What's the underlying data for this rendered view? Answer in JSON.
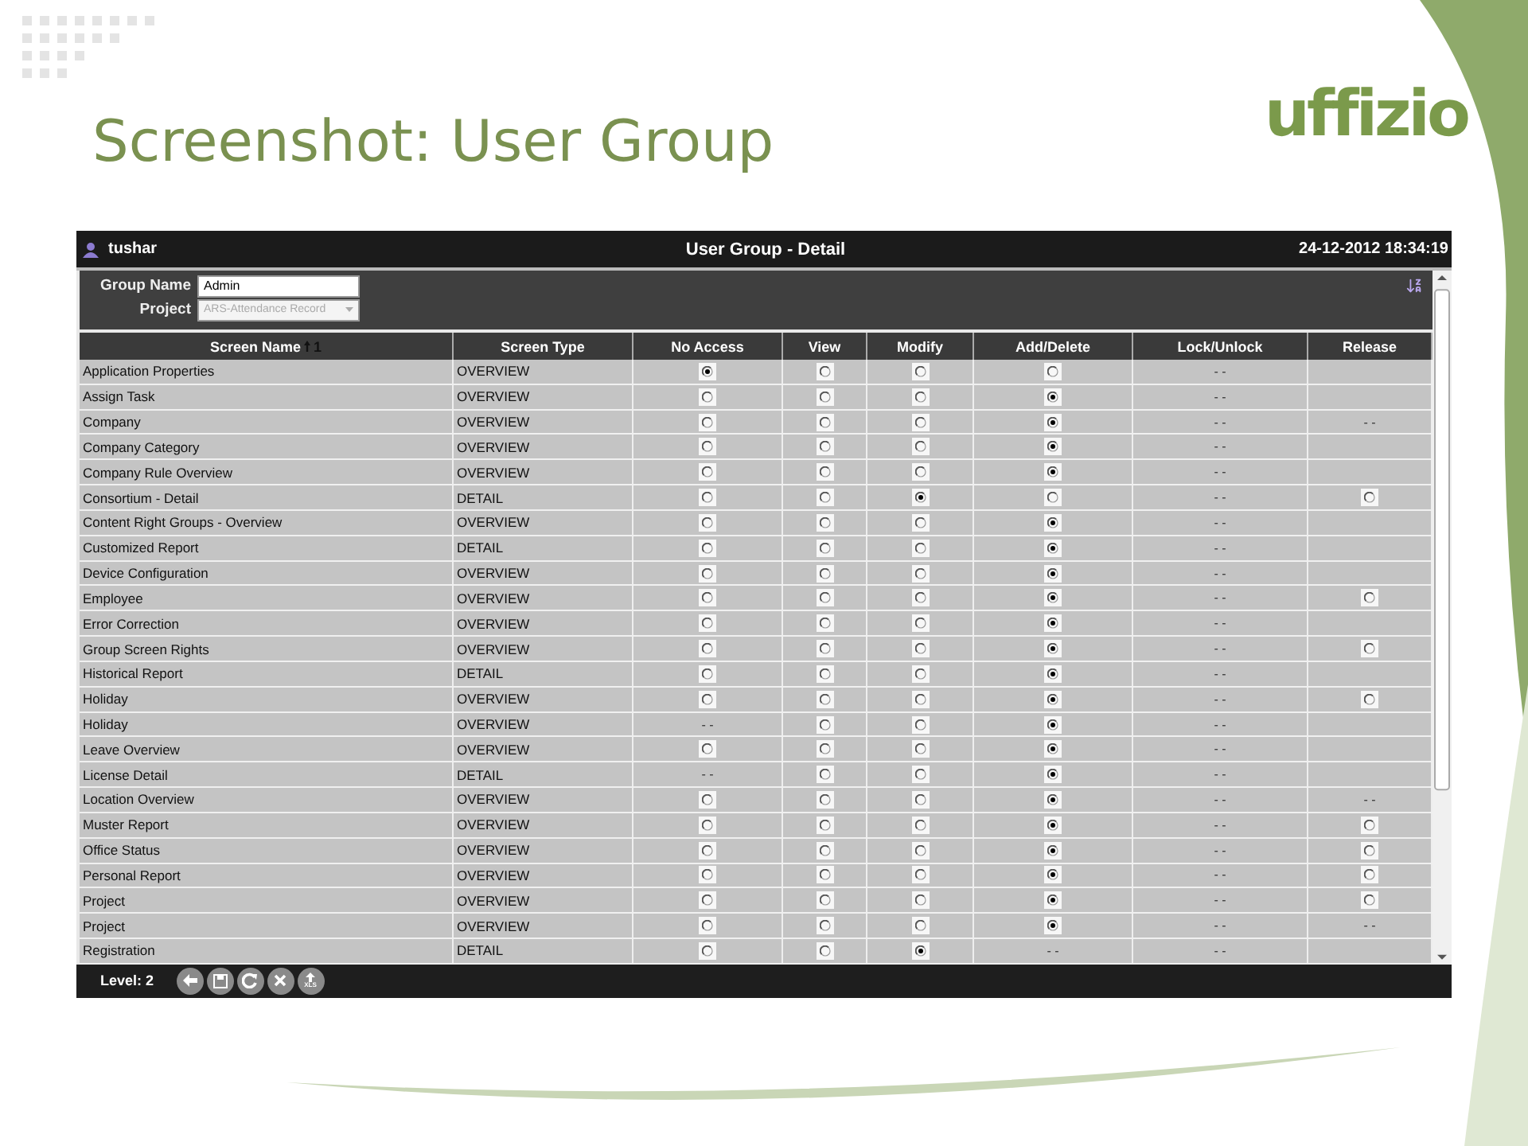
{
  "slide": {
    "title": "Screenshot: User Group",
    "logo": "uffizio"
  },
  "window": {
    "user": "tushar",
    "title": "User Group - Detail",
    "datetime": "24-12-2012 18:34:19"
  },
  "form": {
    "group_name_label": "Group Name",
    "group_name": "Admin",
    "project_label": "Project",
    "project": "ARS-Attendance Record"
  },
  "table": {
    "columns": [
      {
        "label": "Screen Name",
        "sort_rank": "1"
      },
      {
        "label": "Screen Type"
      },
      {
        "label": "No Access"
      },
      {
        "label": "View"
      },
      {
        "label": "Modify"
      },
      {
        "label": "Add/Delete"
      },
      {
        "label": "Lock/Unlock"
      },
      {
        "label": "Release"
      }
    ],
    "rows": [
      {
        "cells": [
          {
            "kind": "text",
            "text": "Application Properties"
          },
          {
            "kind": "text",
            "text": "OVERVIEW"
          },
          {
            "kind": "radio",
            "selected": true
          },
          {
            "kind": "radio",
            "selected": false
          },
          {
            "kind": "radio",
            "selected": false
          },
          {
            "kind": "radio",
            "selected": false
          },
          {
            "kind": "dash",
            "text": "- -"
          },
          {
            "kind": "empty"
          }
        ]
      },
      {
        "cells": [
          {
            "kind": "text",
            "text": "Assign Task"
          },
          {
            "kind": "text",
            "text": "OVERVIEW"
          },
          {
            "kind": "radio",
            "selected": false
          },
          {
            "kind": "radio",
            "selected": false
          },
          {
            "kind": "radio",
            "selected": false
          },
          {
            "kind": "radio",
            "selected": true
          },
          {
            "kind": "dash",
            "text": "- -"
          },
          {
            "kind": "empty"
          }
        ]
      },
      {
        "cells": [
          {
            "kind": "text",
            "text": "Company"
          },
          {
            "kind": "text",
            "text": "OVERVIEW"
          },
          {
            "kind": "radio",
            "selected": false
          },
          {
            "kind": "radio",
            "selected": false
          },
          {
            "kind": "radio",
            "selected": false
          },
          {
            "kind": "radio",
            "selected": true
          },
          {
            "kind": "dash",
            "text": "- -"
          },
          {
            "kind": "dash",
            "text": "- -"
          }
        ]
      },
      {
        "cells": [
          {
            "kind": "text",
            "text": "Company Category"
          },
          {
            "kind": "text",
            "text": "OVERVIEW"
          },
          {
            "kind": "radio",
            "selected": false
          },
          {
            "kind": "radio",
            "selected": false
          },
          {
            "kind": "radio",
            "selected": false
          },
          {
            "kind": "radio",
            "selected": true
          },
          {
            "kind": "dash",
            "text": "- -"
          },
          {
            "kind": "empty"
          }
        ]
      },
      {
        "cells": [
          {
            "kind": "text",
            "text": "Company Rule Overview"
          },
          {
            "kind": "text",
            "text": "OVERVIEW"
          },
          {
            "kind": "radio",
            "selected": false
          },
          {
            "kind": "radio",
            "selected": false
          },
          {
            "kind": "radio",
            "selected": false
          },
          {
            "kind": "radio",
            "selected": true
          },
          {
            "kind": "dash",
            "text": "- -"
          },
          {
            "kind": "empty"
          }
        ]
      },
      {
        "cells": [
          {
            "kind": "text",
            "text": "Consortium - Detail"
          },
          {
            "kind": "text",
            "text": "DETAIL"
          },
          {
            "kind": "radio",
            "selected": false
          },
          {
            "kind": "radio",
            "selected": false
          },
          {
            "kind": "radio",
            "selected": true
          },
          {
            "kind": "radio",
            "selected": false
          },
          {
            "kind": "dash",
            "text": "- -"
          },
          {
            "kind": "radio",
            "selected": false
          }
        ]
      },
      {
        "cells": [
          {
            "kind": "text",
            "text": "Content Right Groups - Overview"
          },
          {
            "kind": "text",
            "text": "OVERVIEW"
          },
          {
            "kind": "radio",
            "selected": false
          },
          {
            "kind": "radio",
            "selected": false
          },
          {
            "kind": "radio",
            "selected": false
          },
          {
            "kind": "radio",
            "selected": true
          },
          {
            "kind": "dash",
            "text": "- -"
          },
          {
            "kind": "empty"
          }
        ]
      },
      {
        "cells": [
          {
            "kind": "text",
            "text": "Customized Report"
          },
          {
            "kind": "text",
            "text": "DETAIL"
          },
          {
            "kind": "radio",
            "selected": false
          },
          {
            "kind": "radio",
            "selected": false
          },
          {
            "kind": "radio",
            "selected": false
          },
          {
            "kind": "radio",
            "selected": true
          },
          {
            "kind": "dash",
            "text": "- -"
          },
          {
            "kind": "empty"
          }
        ]
      },
      {
        "cells": [
          {
            "kind": "text",
            "text": "Device Configuration"
          },
          {
            "kind": "text",
            "text": "OVERVIEW"
          },
          {
            "kind": "radio",
            "selected": false
          },
          {
            "kind": "radio",
            "selected": false
          },
          {
            "kind": "radio",
            "selected": false
          },
          {
            "kind": "radio",
            "selected": true
          },
          {
            "kind": "dash",
            "text": "- -"
          },
          {
            "kind": "empty"
          }
        ]
      },
      {
        "cells": [
          {
            "kind": "text",
            "text": "Employee"
          },
          {
            "kind": "text",
            "text": "OVERVIEW"
          },
          {
            "kind": "radio",
            "selected": false
          },
          {
            "kind": "radio",
            "selected": false
          },
          {
            "kind": "radio",
            "selected": false
          },
          {
            "kind": "radio",
            "selected": true
          },
          {
            "kind": "dash",
            "text": "- -"
          },
          {
            "kind": "radio",
            "selected": false
          }
        ]
      },
      {
        "cells": [
          {
            "kind": "text",
            "text": "Error Correction"
          },
          {
            "kind": "text",
            "text": "OVERVIEW"
          },
          {
            "kind": "radio",
            "selected": false
          },
          {
            "kind": "radio",
            "selected": false
          },
          {
            "kind": "radio",
            "selected": false
          },
          {
            "kind": "radio",
            "selected": true
          },
          {
            "kind": "dash",
            "text": "- -"
          },
          {
            "kind": "empty"
          }
        ]
      },
      {
        "cells": [
          {
            "kind": "text",
            "text": "Group Screen Rights"
          },
          {
            "kind": "text",
            "text": "OVERVIEW"
          },
          {
            "kind": "radio",
            "selected": false
          },
          {
            "kind": "radio",
            "selected": false
          },
          {
            "kind": "radio",
            "selected": false
          },
          {
            "kind": "radio",
            "selected": true
          },
          {
            "kind": "dash",
            "text": "- -"
          },
          {
            "kind": "radio",
            "selected": false
          }
        ]
      },
      {
        "cells": [
          {
            "kind": "text",
            "text": "Historical Report"
          },
          {
            "kind": "text",
            "text": "DETAIL"
          },
          {
            "kind": "radio",
            "selected": false
          },
          {
            "kind": "radio",
            "selected": false
          },
          {
            "kind": "radio",
            "selected": false
          },
          {
            "kind": "radio",
            "selected": true
          },
          {
            "kind": "dash",
            "text": "- -"
          },
          {
            "kind": "empty"
          }
        ]
      },
      {
        "cells": [
          {
            "kind": "text",
            "text": "Holiday"
          },
          {
            "kind": "text",
            "text": "OVERVIEW"
          },
          {
            "kind": "radio",
            "selected": false
          },
          {
            "kind": "radio",
            "selected": false
          },
          {
            "kind": "radio",
            "selected": false
          },
          {
            "kind": "radio",
            "selected": true
          },
          {
            "kind": "dash",
            "text": "- -"
          },
          {
            "kind": "radio",
            "selected": false
          }
        ]
      },
      {
        "cells": [
          {
            "kind": "text",
            "text": "Holiday"
          },
          {
            "kind": "text",
            "text": "OVERVIEW"
          },
          {
            "kind": "dash",
            "text": "- -"
          },
          {
            "kind": "radio",
            "selected": false
          },
          {
            "kind": "radio",
            "selected": false
          },
          {
            "kind": "radio",
            "selected": true
          },
          {
            "kind": "dash",
            "text": "- -"
          },
          {
            "kind": "empty"
          }
        ]
      },
      {
        "cells": [
          {
            "kind": "text",
            "text": "Leave Overview"
          },
          {
            "kind": "text",
            "text": "OVERVIEW"
          },
          {
            "kind": "radio",
            "selected": false
          },
          {
            "kind": "radio",
            "selected": false
          },
          {
            "kind": "radio",
            "selected": false
          },
          {
            "kind": "radio",
            "selected": true
          },
          {
            "kind": "dash",
            "text": "- -"
          },
          {
            "kind": "empty"
          }
        ]
      },
      {
        "cells": [
          {
            "kind": "text",
            "text": "License Detail"
          },
          {
            "kind": "text",
            "text": "DETAIL"
          },
          {
            "kind": "dash",
            "text": "- -"
          },
          {
            "kind": "radio",
            "selected": false
          },
          {
            "kind": "radio",
            "selected": false
          },
          {
            "kind": "radio",
            "selected": true
          },
          {
            "kind": "dash",
            "text": "- -"
          },
          {
            "kind": "empty"
          }
        ]
      },
      {
        "cells": [
          {
            "kind": "text",
            "text": "Location Overview"
          },
          {
            "kind": "text",
            "text": "OVERVIEW"
          },
          {
            "kind": "radio",
            "selected": false
          },
          {
            "kind": "radio",
            "selected": false
          },
          {
            "kind": "radio",
            "selected": false
          },
          {
            "kind": "radio",
            "selected": true
          },
          {
            "kind": "dash",
            "text": "- -"
          },
          {
            "kind": "dash",
            "text": "- -"
          }
        ]
      },
      {
        "cells": [
          {
            "kind": "text",
            "text": "Muster Report"
          },
          {
            "kind": "text",
            "text": "OVERVIEW"
          },
          {
            "kind": "radio",
            "selected": false
          },
          {
            "kind": "radio",
            "selected": false
          },
          {
            "kind": "radio",
            "selected": false
          },
          {
            "kind": "radio",
            "selected": true
          },
          {
            "kind": "dash",
            "text": "- -"
          },
          {
            "kind": "radio",
            "selected": false
          }
        ]
      },
      {
        "cells": [
          {
            "kind": "text",
            "text": "Office Status"
          },
          {
            "kind": "text",
            "text": "OVERVIEW"
          },
          {
            "kind": "radio",
            "selected": false
          },
          {
            "kind": "radio",
            "selected": false
          },
          {
            "kind": "radio",
            "selected": false
          },
          {
            "kind": "radio",
            "selected": true
          },
          {
            "kind": "dash",
            "text": "- -"
          },
          {
            "kind": "radio",
            "selected": false
          }
        ]
      },
      {
        "cells": [
          {
            "kind": "text",
            "text": "Personal Report"
          },
          {
            "kind": "text",
            "text": "OVERVIEW"
          },
          {
            "kind": "radio",
            "selected": false
          },
          {
            "kind": "radio",
            "selected": false
          },
          {
            "kind": "radio",
            "selected": false
          },
          {
            "kind": "radio",
            "selected": true
          },
          {
            "kind": "dash",
            "text": "- -"
          },
          {
            "kind": "radio",
            "selected": false
          }
        ]
      },
      {
        "cells": [
          {
            "kind": "text",
            "text": "Project"
          },
          {
            "kind": "text",
            "text": "OVERVIEW"
          },
          {
            "kind": "radio",
            "selected": false
          },
          {
            "kind": "radio",
            "selected": false
          },
          {
            "kind": "radio",
            "selected": false
          },
          {
            "kind": "radio",
            "selected": true
          },
          {
            "kind": "dash",
            "text": "- -"
          },
          {
            "kind": "radio",
            "selected": false
          }
        ]
      },
      {
        "cells": [
          {
            "kind": "text",
            "text": "Project"
          },
          {
            "kind": "text",
            "text": "OVERVIEW"
          },
          {
            "kind": "radio",
            "selected": false
          },
          {
            "kind": "radio",
            "selected": false
          },
          {
            "kind": "radio",
            "selected": false
          },
          {
            "kind": "radio",
            "selected": true
          },
          {
            "kind": "dash",
            "text": "- -"
          },
          {
            "kind": "dash",
            "text": "- -"
          }
        ]
      },
      {
        "cells": [
          {
            "kind": "text",
            "text": "Registration"
          },
          {
            "kind": "text",
            "text": "DETAIL"
          },
          {
            "kind": "radio",
            "selected": false
          },
          {
            "kind": "radio",
            "selected": false
          },
          {
            "kind": "radio",
            "selected": true
          },
          {
            "kind": "dash",
            "text": "- -"
          },
          {
            "kind": "dash",
            "text": "- -"
          },
          {
            "kind": "empty"
          }
        ]
      }
    ]
  },
  "footer": {
    "level": "Level: 2",
    "xls_label": "XLS"
  }
}
